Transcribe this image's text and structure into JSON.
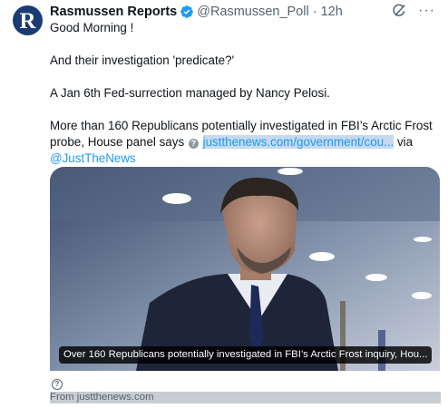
{
  "author": {
    "initial": "R",
    "name": "Rasmussen Reports",
    "handle": "@Rasmussen_Poll",
    "separator": "·",
    "time": "12h",
    "verified_color": "#1d9bf0"
  },
  "actions": {
    "grok_icon": "grok-icon",
    "more": "···"
  },
  "post": {
    "line1": "Good Morning !",
    "line2": "And their investigation 'predicate?'",
    "line3": "A Jan 6th Fed-surrection managed by Nancy Pelosi.",
    "line4_pre": "More than 160 Republicans potentially investigated in FBI’s Arctic Frost probe, House panel says",
    "link": "justthenews.com/government/cou...",
    "via": "via",
    "mention": "@JustTheNews"
  },
  "card": {
    "caption": "Over 160 Republicans potentially investigated in FBI’s Arctic Frost inquiry, Hou...",
    "help_glyph": "?",
    "source": "From justthenews.com"
  }
}
